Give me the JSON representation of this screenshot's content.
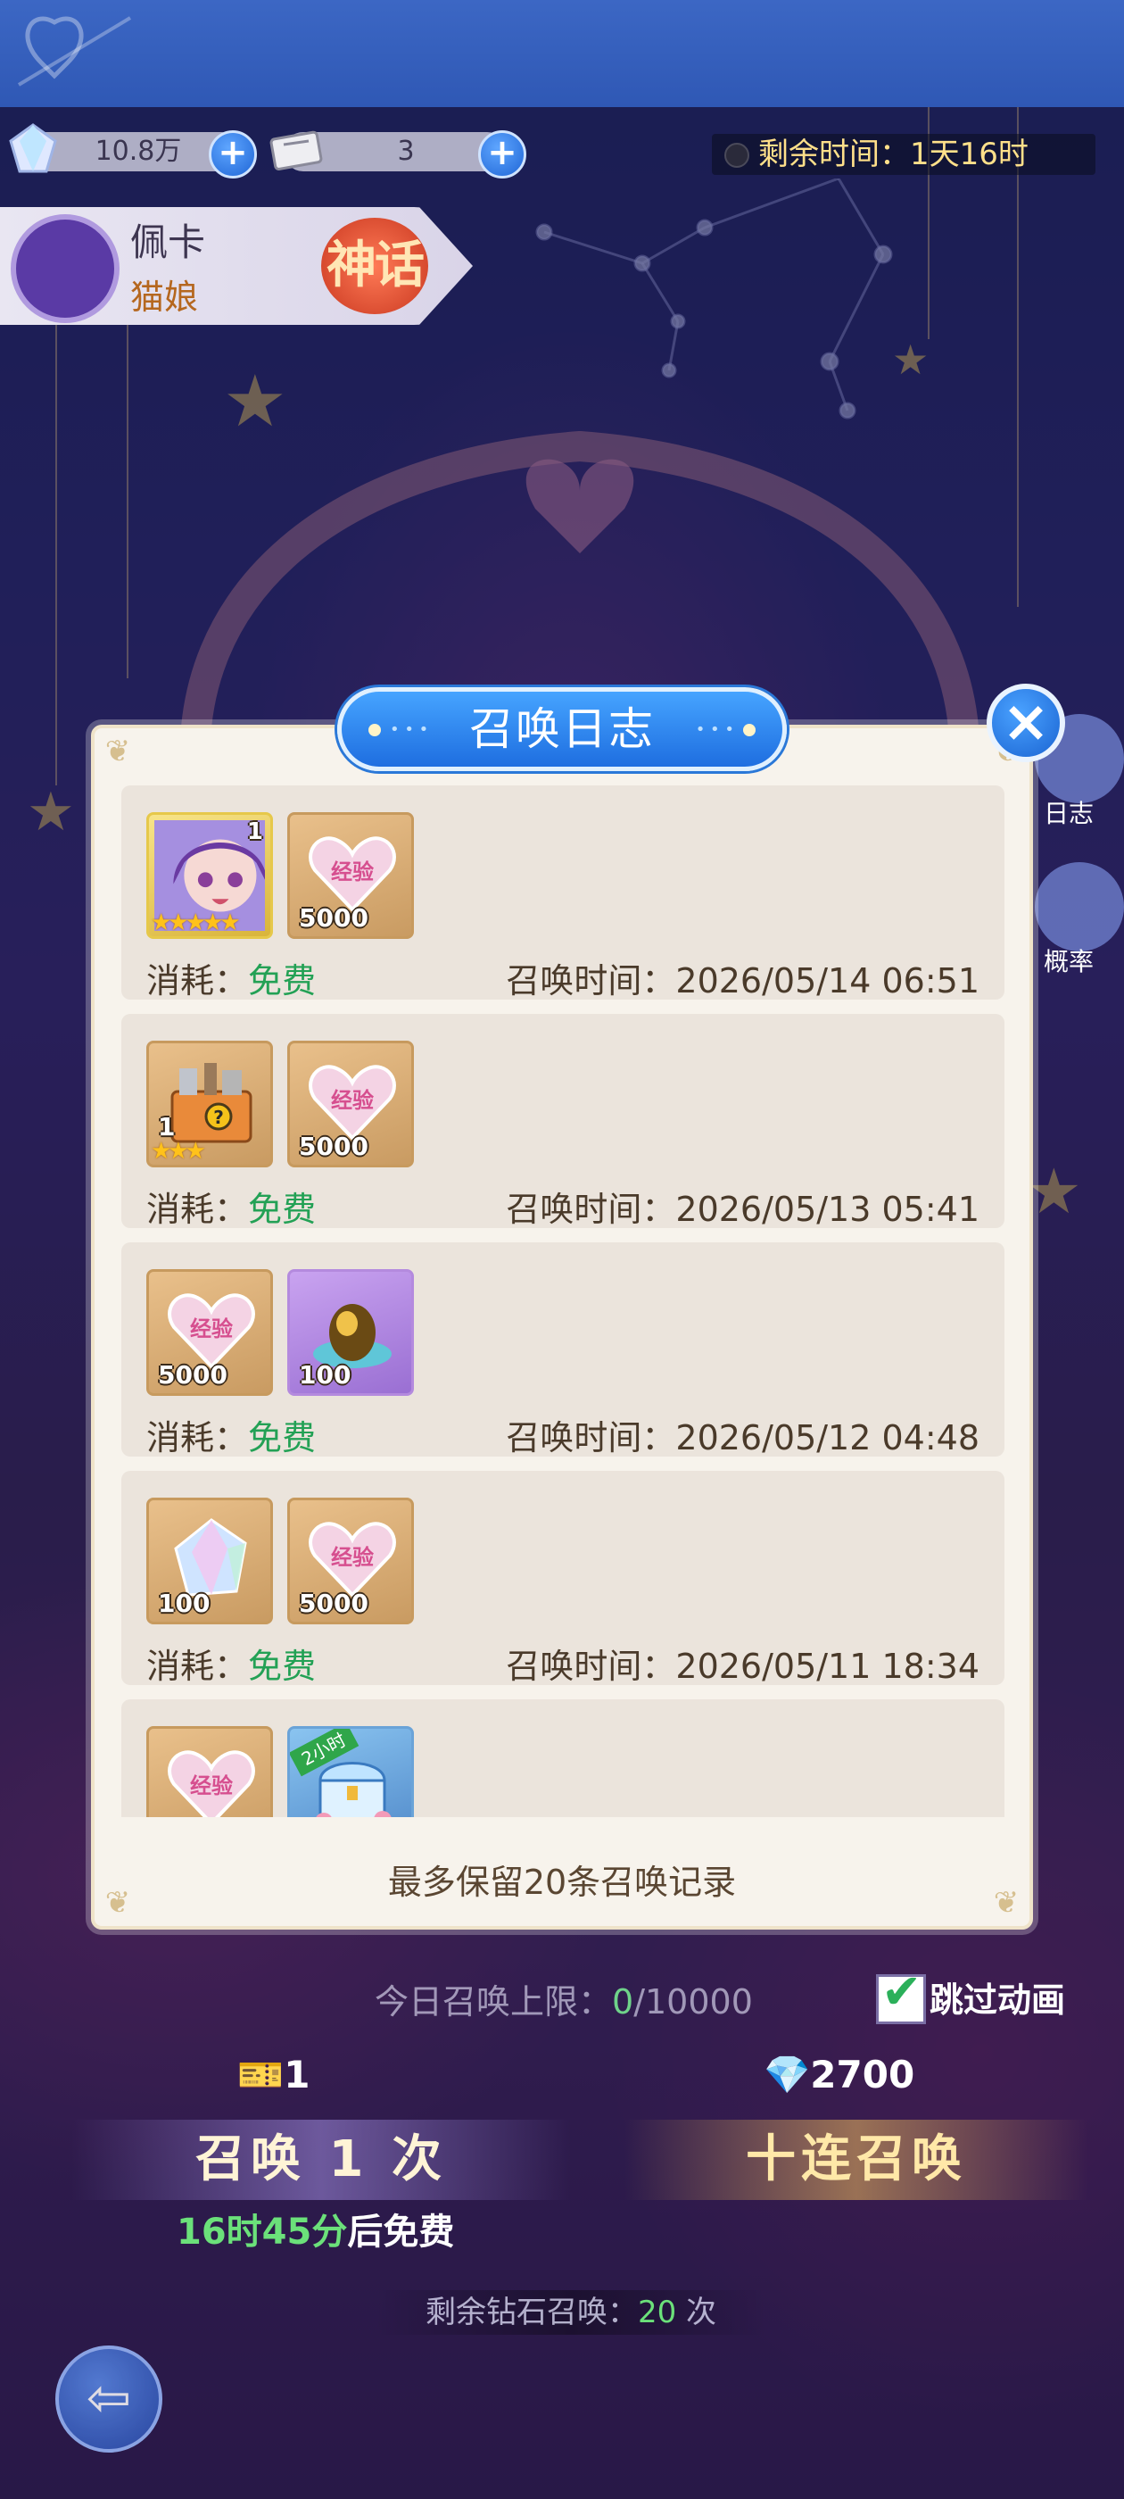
{
  "currency": {
    "diamonds": "10.8万",
    "tickets": "3"
  },
  "event_timer": "剩余时间：1天16时",
  "hero": {
    "name": "佩卡",
    "race": "猫娘",
    "rarity": "神话"
  },
  "side_buttons": {
    "log_label": "日志",
    "rate_label": "概率"
  },
  "modal": {
    "title": "召唤日志",
    "close_icon": "close-icon",
    "footer_note": "最多保留20条召唤记录",
    "entries": [
      {
        "items": [
          {
            "icon": "hero-portrait",
            "count_top": "1",
            "stars": "★★★★★"
          },
          {
            "icon": "exp-heart",
            "art_text": "经验",
            "count": "5000"
          }
        ],
        "cost_label": "消耗：",
        "cost_value": "免费",
        "time_label": "召唤时间：2026/05/14 06:51"
      },
      {
        "items": [
          {
            "icon": "random-chest",
            "count": "1",
            "stars": "★★★"
          },
          {
            "icon": "exp-heart",
            "art_text": "经验",
            "count": "5000"
          }
        ],
        "cost_label": "消耗：",
        "cost_value": "免费",
        "time_label": "召唤时间：2026/05/13 05:41"
      },
      {
        "items": [
          {
            "icon": "exp-heart",
            "art_text": "经验",
            "count": "5000"
          },
          {
            "icon": "golden-egg",
            "count": "100"
          }
        ],
        "cost_label": "消耗：",
        "cost_value": "免费",
        "time_label": "召唤时间：2026/05/12 04:48"
      },
      {
        "items": [
          {
            "icon": "crystal",
            "count": "100"
          },
          {
            "icon": "exp-heart",
            "art_text": "经验",
            "count": "5000"
          }
        ],
        "cost_label": "消耗：",
        "cost_value": "免费",
        "time_label": "召唤时间：2026/05/11 18:34"
      },
      {
        "items": [
          {
            "icon": "exp-heart",
            "art_text": "经验",
            "count": ""
          },
          {
            "icon": "treasure-chest",
            "ribbon": "2小时",
            "count": ""
          }
        ]
      }
    ]
  },
  "bottom": {
    "daily_limit_label": "今日召唤上限：",
    "daily_limit_used": "0",
    "daily_limit_total": "/10000",
    "skip_animation_label": "跳过动画",
    "skip_animation_checked": true,
    "single_cost": "1",
    "ten_cost": "2700",
    "summon_one_label": "召唤 1 次",
    "summon_ten_label": "十连召唤",
    "free_time": "16时45分",
    "free_suffix": "后免费",
    "remain_diamond_label": "剩余钻石召唤：",
    "remain_diamond_count": "20",
    "remain_diamond_unit": "次"
  },
  "colors": {
    "accent_blue": "#2f7ee8",
    "free_green": "#23a155",
    "item_frame_gold": "#c79a5e"
  }
}
